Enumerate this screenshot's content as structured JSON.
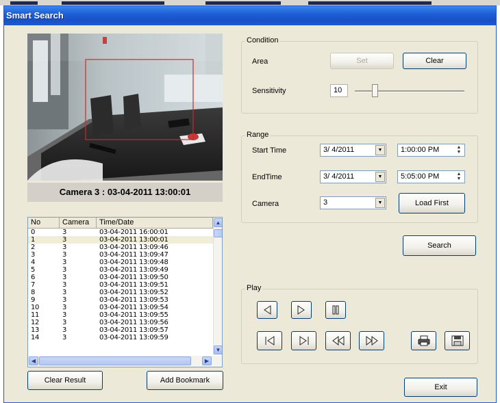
{
  "window": {
    "title": "Smart Search"
  },
  "preview": {
    "caption": "Camera 3 : 03-04-2011 13:00:01"
  },
  "results": {
    "columns": [
      "No",
      "Camera",
      "Time/Date"
    ],
    "rows": [
      [
        "0",
        "3",
        "03-04-2011 16:00:01"
      ],
      [
        "1",
        "3",
        "03-04-2011 13:00:01"
      ],
      [
        "2",
        "3",
        "03-04-2011 13:09:46"
      ],
      [
        "3",
        "3",
        "03-04-2011 13:09:47"
      ],
      [
        "4",
        "3",
        "03-04-2011 13:09:48"
      ],
      [
        "5",
        "3",
        "03-04-2011 13:09:49"
      ],
      [
        "6",
        "3",
        "03-04-2011 13:09:50"
      ],
      [
        "7",
        "3",
        "03-04-2011 13:09:51"
      ],
      [
        "8",
        "3",
        "03-04-2011 13:09:52"
      ],
      [
        "9",
        "3",
        "03-04-2011 13:09:53"
      ],
      [
        "10",
        "3",
        "03-04-2011 13:09:54"
      ],
      [
        "11",
        "3",
        "03-04-2011 13:09:55"
      ],
      [
        "12",
        "3",
        "03-04-2011 13:09:56"
      ],
      [
        "13",
        "3",
        "03-04-2011 13:09:57"
      ],
      [
        "14",
        "3",
        "03-04-2011 13:09:59"
      ]
    ],
    "selected_row": "1"
  },
  "buttons": {
    "clear_result": "Clear Result",
    "add_bookmark": "Add Bookmark",
    "search": "Search",
    "exit": "Exit"
  },
  "condition": {
    "legend": "Condition",
    "area_label": "Area",
    "set_label": "Set",
    "clear_label": "Clear",
    "sensitivity_label": "Sensitivity",
    "sensitivity_value": "10",
    "sensitivity_level": 0.1
  },
  "range": {
    "legend": "Range",
    "start_label": "Start Time",
    "start_date": "3/ 4/2011",
    "start_time": "1:00:00 PM",
    "end_label": "EndTime",
    "end_date": "3/ 4/2011",
    "end_time": "5:05:00 PM",
    "camera_label": "Camera",
    "camera_value": "3",
    "load_first": "Load First"
  },
  "play": {
    "legend": "Play"
  },
  "icons": [
    "step-back-icon",
    "step-forward-icon",
    "pause-icon",
    "skip-to-start-icon",
    "skip-to-end-icon",
    "rewind-icon",
    "fast-forward-icon",
    "print-icon",
    "save-snapshot-icon"
  ],
  "colors": {
    "titlebar": "#1e5fd6",
    "detection_area": "#e02020",
    "selection": "#f0edd8"
  }
}
